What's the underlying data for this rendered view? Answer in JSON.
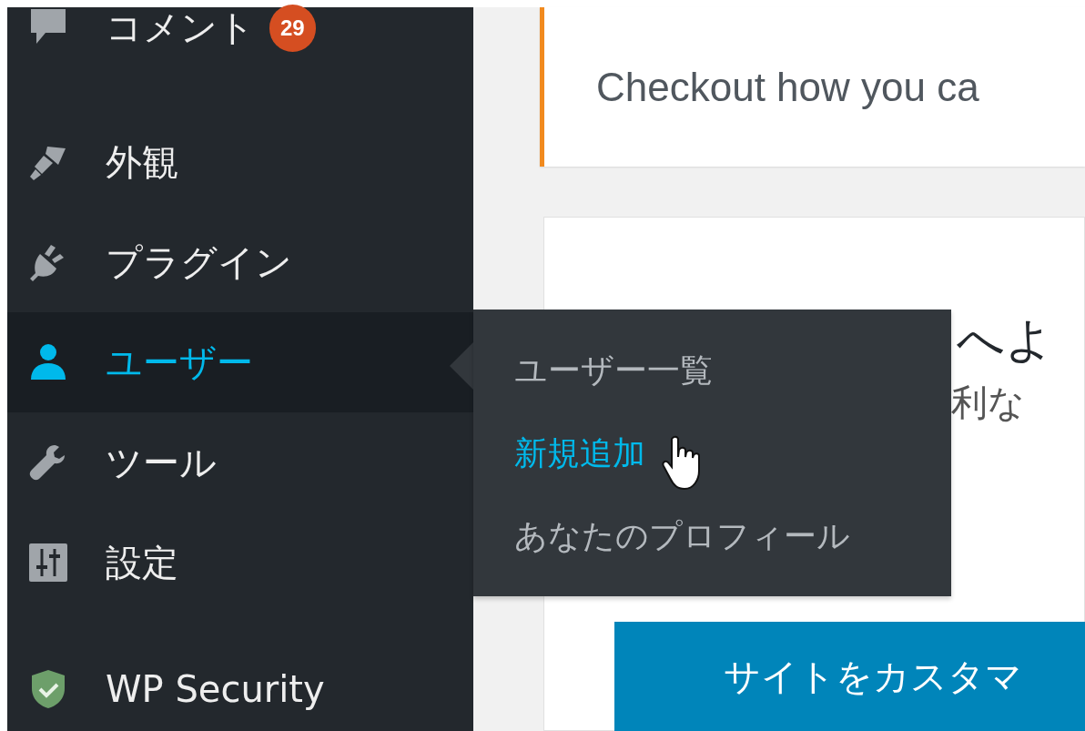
{
  "sidebar": {
    "items": [
      {
        "label": "コメント",
        "kind": "comment",
        "badge": "29",
        "selected": false
      },
      {
        "label": "外観",
        "kind": "brush",
        "selected": false
      },
      {
        "label": "プラグイン",
        "kind": "plug",
        "selected": false
      },
      {
        "label": "ユーザー",
        "kind": "user",
        "selected": true
      },
      {
        "label": "ツール",
        "kind": "wrench",
        "selected": false
      },
      {
        "label": "設定",
        "kind": "sliders",
        "selected": false
      },
      {
        "label": "WP Security",
        "kind": "shield",
        "selected": false
      }
    ]
  },
  "flyout": {
    "items": [
      {
        "label": "ユーザー一覧",
        "selected": false
      },
      {
        "label": "新規追加",
        "selected": true
      },
      {
        "label": "あなたのプロフィール",
        "selected": false
      }
    ]
  },
  "notice": {
    "text": "Checkout how you ca"
  },
  "welcome": {
    "heading": "へよ",
    "subtext": "利な",
    "button": "サイトをカスタマ"
  }
}
